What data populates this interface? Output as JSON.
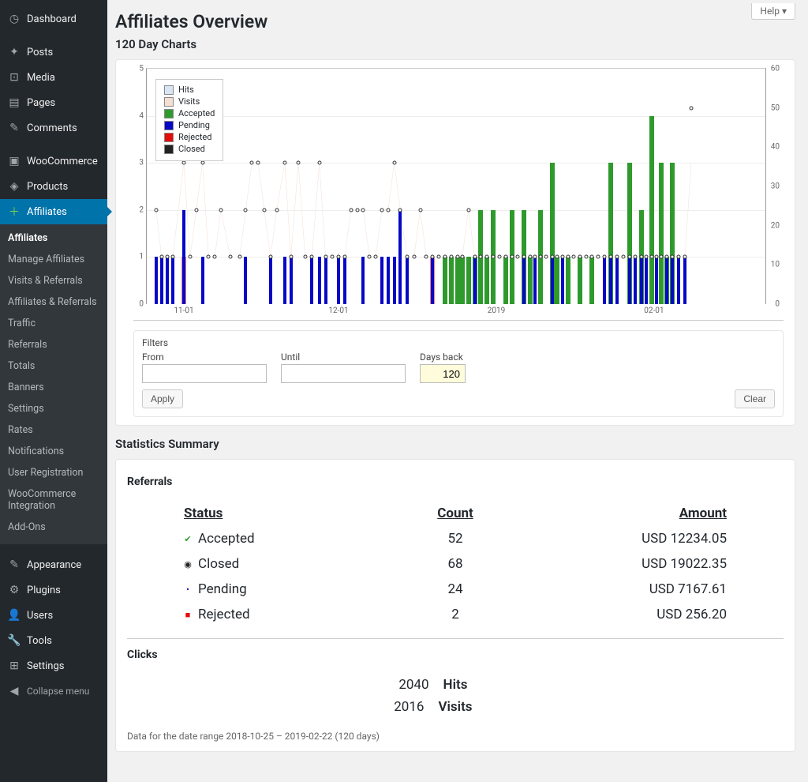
{
  "help_label": "Help",
  "page_title": "Affiliates Overview",
  "section_title_charts": "120 Day Charts",
  "sidebar": {
    "items": [
      {
        "label": "Dashboard",
        "icon": "◷"
      },
      {
        "label": "Posts",
        "icon": "✦"
      },
      {
        "label": "Media",
        "icon": "⊡"
      },
      {
        "label": "Pages",
        "icon": "▤"
      },
      {
        "label": "Comments",
        "icon": "✎"
      },
      {
        "label": "WooCommerce",
        "icon": "▣"
      },
      {
        "label": "Products",
        "icon": "◈"
      },
      {
        "label": "Affiliates",
        "icon": "＋"
      },
      {
        "label": "Appearance",
        "icon": "✎"
      },
      {
        "label": "Plugins",
        "icon": "⚙"
      },
      {
        "label": "Users",
        "icon": "👤"
      },
      {
        "label": "Tools",
        "icon": "🔧"
      },
      {
        "label": "Settings",
        "icon": "⊞"
      },
      {
        "label": "Collapse menu",
        "icon": "◀"
      }
    ],
    "sub": [
      "Affiliates",
      "Manage Affiliates",
      "Visits & Referrals",
      "Affiliates & Referrals",
      "Traffic",
      "Referrals",
      "Totals",
      "Banners",
      "Settings",
      "Rates",
      "Notifications",
      "User Registration",
      "WooCommerce Integration",
      "Add-Ons"
    ]
  },
  "chart_data": {
    "type": "bar",
    "title": "120 Day Charts",
    "ylabel_left": "",
    "ylim_left": [
      0,
      5
    ],
    "ylabel_right": "",
    "ylim_right": [
      0,
      60
    ],
    "x_ticks": [
      "11-01",
      "12-01",
      "2019",
      "02-01"
    ],
    "x_tick_positions": [
      0.06,
      0.31,
      0.565,
      0.82
    ],
    "legend": [
      "Hits",
      "Visits",
      "Accepted",
      "Pending",
      "Rejected",
      "Closed"
    ],
    "legend_colors": {
      "Hits": "#d9e5f5",
      "Visits": "#f5ded3",
      "Accepted": "#2e9a2c",
      "Pending": "#0707c7",
      "Rejected": "#e30b0b",
      "Closed": "#222222"
    },
    "points": [
      {
        "x": 0.015,
        "p": 1,
        "a": 0,
        "h": 2
      },
      {
        "x": 0.024,
        "p": 1,
        "a": 0,
        "h": 1
      },
      {
        "x": 0.033,
        "p": 1,
        "a": 0,
        "h": 1
      },
      {
        "x": 0.042,
        "p": 1,
        "a": 0,
        "h": 1
      },
      {
        "x": 0.06,
        "p": 2,
        "a": 0,
        "h": 3,
        "r": 1
      },
      {
        "x": 0.07,
        "p": 0,
        "a": 0,
        "h": 1
      },
      {
        "x": 0.08,
        "p": 0,
        "a": 0,
        "h": 2
      },
      {
        "x": 0.09,
        "p": 1,
        "a": 0,
        "h": 3
      },
      {
        "x": 0.1,
        "p": 0,
        "a": 0,
        "h": 1
      },
      {
        "x": 0.11,
        "p": 0,
        "a": 0,
        "h": 1
      },
      {
        "x": 0.12,
        "p": 0,
        "a": 0,
        "h": 2
      },
      {
        "x": 0.135,
        "p": 0,
        "a": 0,
        "h": 1
      },
      {
        "x": 0.15,
        "p": 0,
        "a": 0,
        "h": 1
      },
      {
        "x": 0.16,
        "p": 1,
        "a": 0,
        "h": 2
      },
      {
        "x": 0.17,
        "p": 0,
        "a": 0,
        "h": 3
      },
      {
        "x": 0.18,
        "p": 0,
        "a": 0,
        "h": 3
      },
      {
        "x": 0.19,
        "p": 0,
        "a": 0,
        "h": 2
      },
      {
        "x": 0.2,
        "p": 1,
        "a": 0,
        "h": 1
      },
      {
        "x": 0.21,
        "p": 0,
        "a": 0,
        "h": 2
      },
      {
        "x": 0.223,
        "p": 1,
        "a": 0,
        "h": 3
      },
      {
        "x": 0.233,
        "p": 1,
        "a": 0,
        "h": 1
      },
      {
        "x": 0.245,
        "p": 0,
        "a": 0,
        "h": 3
      },
      {
        "x": 0.256,
        "p": 0,
        "a": 0,
        "h": 1
      },
      {
        "x": 0.267,
        "p": 1,
        "a": 0,
        "h": 1
      },
      {
        "x": 0.279,
        "p": 1,
        "a": 0,
        "h": 3
      },
      {
        "x": 0.289,
        "p": 1,
        "a": 0,
        "h": 1
      },
      {
        "x": 0.3,
        "p": 0,
        "a": 0,
        "h": 1
      },
      {
        "x": 0.31,
        "p": 1,
        "a": 0,
        "h": 1
      },
      {
        "x": 0.32,
        "p": 1,
        "a": 0,
        "h": 1
      },
      {
        "x": 0.33,
        "p": 0,
        "a": 0,
        "h": 2
      },
      {
        "x": 0.34,
        "p": 0,
        "a": 0,
        "h": 2
      },
      {
        "x": 0.35,
        "p": 1,
        "a": 0,
        "h": 2
      },
      {
        "x": 0.36,
        "p": 0,
        "a": 0,
        "h": 1
      },
      {
        "x": 0.37,
        "p": 0,
        "a": 0,
        "h": 1
      },
      {
        "x": 0.38,
        "p": 1,
        "a": 0,
        "h": 2
      },
      {
        "x": 0.39,
        "p": 1,
        "a": 0,
        "h": 2
      },
      {
        "x": 0.4,
        "p": 1,
        "a": 0,
        "h": 3
      },
      {
        "x": 0.41,
        "p": 2,
        "a": 0,
        "h": 2
      },
      {
        "x": 0.421,
        "p": 1,
        "a": 0,
        "h": 1
      },
      {
        "x": 0.432,
        "p": 0,
        "a": 0,
        "h": 1
      },
      {
        "x": 0.442,
        "p": 0,
        "a": 0,
        "h": 2
      },
      {
        "x": 0.452,
        "p": 0,
        "a": 0,
        "h": 1
      },
      {
        "x": 0.462,
        "p": 1,
        "a": 0,
        "h": 1,
        "r": 1
      },
      {
        "x": 0.472,
        "p": 0,
        "a": 0,
        "h": 1
      },
      {
        "x": 0.482,
        "p": 0,
        "a": 1,
        "h": 1
      },
      {
        "x": 0.492,
        "p": 0,
        "a": 1,
        "h": 1
      },
      {
        "x": 0.502,
        "p": 0,
        "a": 1,
        "h": 1
      },
      {
        "x": 0.51,
        "p": 0,
        "a": 1,
        "h": 1
      },
      {
        "x": 0.52,
        "p": 0,
        "a": 1,
        "h": 2
      },
      {
        "x": 0.53,
        "p": 1,
        "a": 1,
        "h": 1
      },
      {
        "x": 0.54,
        "p": 0,
        "a": 2,
        "h": 1
      },
      {
        "x": 0.55,
        "p": 0,
        "a": 1,
        "h": 1
      },
      {
        "x": 0.56,
        "p": 0,
        "a": 2,
        "h": 1
      },
      {
        "x": 0.57,
        "p": 0,
        "a": 0,
        "h": 1
      },
      {
        "x": 0.58,
        "p": 0,
        "a": 1,
        "h": 1
      },
      {
        "x": 0.59,
        "p": 0,
        "a": 2,
        "h": 1
      },
      {
        "x": 0.6,
        "p": 0,
        "a": 0,
        "h": 1
      },
      {
        "x": 0.61,
        "p": 1,
        "a": 2,
        "h": 1
      },
      {
        "x": 0.62,
        "p": 0,
        "a": 1,
        "h": 1
      },
      {
        "x": 0.628,
        "p": 1,
        "a": 0,
        "h": 1
      },
      {
        "x": 0.637,
        "p": 0,
        "a": 2,
        "h": 1
      },
      {
        "x": 0.646,
        "p": 0,
        "a": 0,
        "h": 1
      },
      {
        "x": 0.655,
        "p": 1,
        "a": 3,
        "h": 1
      },
      {
        "x": 0.663,
        "p": 0,
        "a": 1,
        "h": 1
      },
      {
        "x": 0.672,
        "p": 1,
        "a": 0,
        "h": 1
      },
      {
        "x": 0.681,
        "p": 0,
        "a": 1,
        "h": 1
      },
      {
        "x": 0.69,
        "p": 0,
        "a": 0,
        "h": 1
      },
      {
        "x": 0.7,
        "p": 0,
        "a": 1,
        "h": 1
      },
      {
        "x": 0.71,
        "p": 0,
        "a": 0,
        "h": 1
      },
      {
        "x": 0.72,
        "p": 0,
        "a": 1,
        "h": 1
      },
      {
        "x": 0.73,
        "p": 0,
        "a": 0,
        "h": 1
      },
      {
        "x": 0.74,
        "p": 1,
        "a": 0,
        "h": 1
      },
      {
        "x": 0.75,
        "p": 1,
        "a": 3,
        "h": 1
      },
      {
        "x": 0.76,
        "p": 1,
        "a": 0,
        "h": 1
      },
      {
        "x": 0.77,
        "p": 0,
        "a": 0,
        "h": 1
      },
      {
        "x": 0.78,
        "p": 1,
        "a": 3,
        "h": 1
      },
      {
        "x": 0.79,
        "p": 1,
        "a": 0,
        "h": 1
      },
      {
        "x": 0.8,
        "p": 1,
        "a": 2,
        "h": 1
      },
      {
        "x": 0.808,
        "p": 1,
        "a": 0,
        "h": 1
      },
      {
        "x": 0.816,
        "p": 0,
        "a": 4,
        "h": 1
      },
      {
        "x": 0.824,
        "p": 1,
        "a": 0,
        "h": 1
      },
      {
        "x": 0.832,
        "p": 0,
        "a": 3,
        "h": 1
      },
      {
        "x": 0.84,
        "p": 1,
        "a": 1,
        "h": 1
      },
      {
        "x": 0.85,
        "p": 1,
        "a": 3,
        "h": 1
      },
      {
        "x": 0.86,
        "p": 1,
        "a": 0,
        "h": 1
      },
      {
        "x": 0.87,
        "p": 1,
        "a": 0,
        "h": 1
      },
      {
        "x": 0.88,
        "p": 0,
        "a": 0,
        "h": 50,
        "o": true
      }
    ]
  },
  "filters": {
    "title": "Filters",
    "from_label": "From",
    "until_label": "Until",
    "days_back_label": "Days back",
    "days_back_value": "120",
    "apply": "Apply",
    "clear": "Clear"
  },
  "stats": {
    "title": "Statistics Summary",
    "referrals_title": "Referrals",
    "headers": {
      "status": "Status",
      "count": "Count",
      "amount": "Amount"
    },
    "rows": [
      {
        "status": "Accepted",
        "count": "52",
        "amount": "USD 12234.05",
        "color": "#2e9a2c",
        "mark": "✔"
      },
      {
        "status": "Closed",
        "count": "68",
        "amount": "USD 19022.35",
        "color": "#222222",
        "mark": "◉"
      },
      {
        "status": "Pending",
        "count": "24",
        "amount": "USD 7167.61",
        "color": "#0707c7",
        "mark": "•"
      },
      {
        "status": "Rejected",
        "count": "2",
        "amount": "USD 256.20",
        "color": "#e30b0b",
        "mark": "■"
      }
    ],
    "clicks_title": "Clicks",
    "clicks": [
      {
        "n": "2040",
        "l": "Hits"
      },
      {
        "n": "2016",
        "l": "Visits"
      }
    ],
    "range_note": "Data for the date range 2018-10-25 – 2019-02-22 (120 days)"
  }
}
